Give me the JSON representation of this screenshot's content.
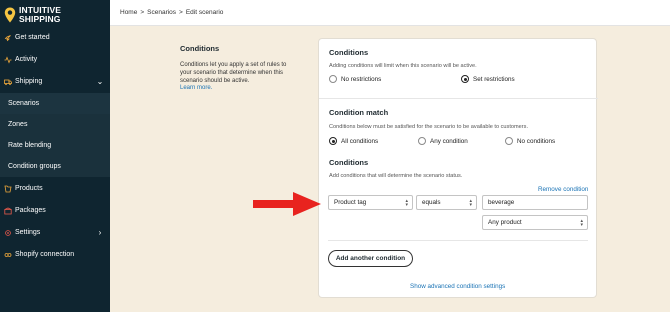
{
  "brand": {
    "name_line1": "INTUITIVE",
    "name_line2": "SHIPPING",
    "color": "#f5c542"
  },
  "sidebar": {
    "items": [
      {
        "label": "Get started",
        "icon": "rocket-icon"
      },
      {
        "label": "Activity",
        "icon": "activity-icon"
      },
      {
        "label": "Shipping",
        "icon": "shipping-icon",
        "expanded": true
      },
      {
        "label": "Scenarios"
      },
      {
        "label": "Zones"
      },
      {
        "label": "Rate blending"
      },
      {
        "label": "Condition groups"
      },
      {
        "label": "Products",
        "icon": "products-icon"
      },
      {
        "label": "Packages",
        "icon": "packages-icon"
      },
      {
        "label": "Settings",
        "icon": "settings-icon"
      },
      {
        "label": "Shopify connection",
        "icon": "shopify-icon"
      }
    ]
  },
  "breadcrumb": {
    "home": "Home",
    "sep1": ">",
    "scenarios": "Scenarios",
    "sep2": ">",
    "current": "Edit scenario"
  },
  "intro": {
    "title": "Conditions",
    "text": "Conditions let you apply a set of rules to your scenario that determine when this scenario should be active.",
    "link": "Learn more."
  },
  "conditions_section": {
    "title": "Conditions",
    "help": "Adding conditions will limit when this scenario will be active.",
    "options": [
      "No restrictions",
      "Set restrictions"
    ],
    "selected": "Set restrictions"
  },
  "match_section": {
    "title": "Condition match",
    "help": "Conditions below must be satisfied for the scenario to be available to customers.",
    "options": [
      "All conditions",
      "Any condition",
      "No conditions"
    ],
    "selected": "All conditions"
  },
  "rules_section": {
    "title": "Conditions",
    "help": "Add conditions that will determine the scenario status.",
    "remove_label": "Remove condition",
    "field": "Product tag",
    "operator": "equals",
    "value": "beverage",
    "scope": "Any product",
    "add_label": "Add another condition",
    "advanced_label": "Show advanced condition settings"
  },
  "colors": {
    "sidebar_bg": "#0f2530",
    "page_bg": "#f5edde",
    "link": "#1a73b5",
    "arrow": "#e8231f"
  }
}
